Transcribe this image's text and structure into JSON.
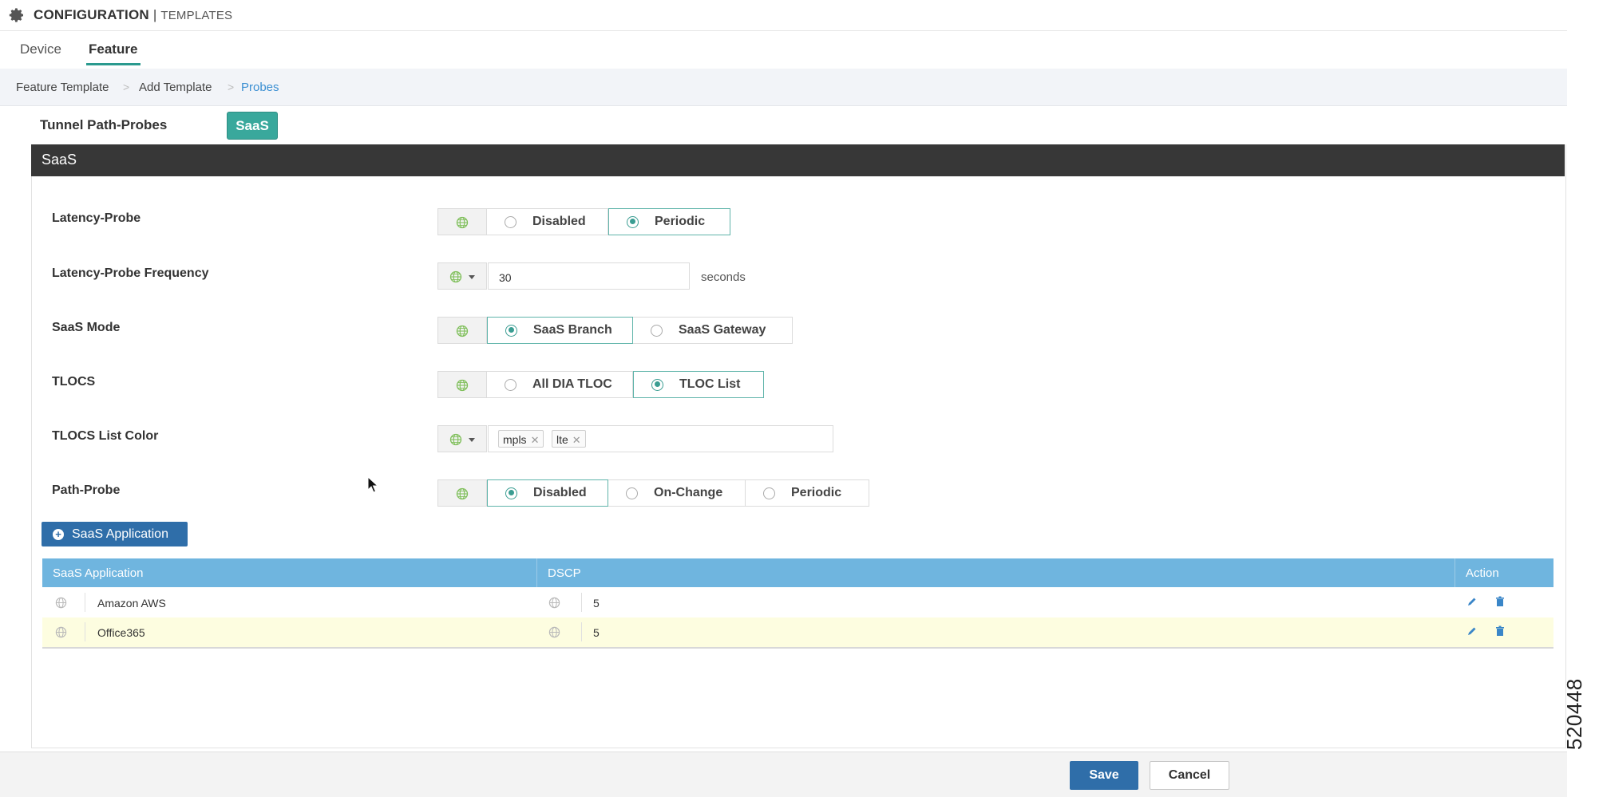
{
  "header": {
    "title": "CONFIGURATION",
    "separator": " | ",
    "subtitle": "TEMPLATES"
  },
  "tabs": [
    {
      "label": "Device"
    },
    {
      "label": "Feature",
      "active": true
    }
  ],
  "breadcrumb": {
    "items": [
      "Feature Template",
      "Add Template",
      "Probes"
    ],
    "separator": ">"
  },
  "probes": {
    "label": "Tunnel Path-Probes",
    "chip": "SaaS"
  },
  "panel": {
    "title": "SaaS"
  },
  "fields": {
    "latency_probe": {
      "label": "Latency-Probe",
      "options": [
        "Disabled",
        "Periodic"
      ],
      "selected": "Periodic"
    },
    "latency_freq": {
      "label": "Latency-Probe Frequency",
      "value": "30",
      "unit": "seconds"
    },
    "saas_mode": {
      "label": "SaaS Mode",
      "options": [
        "SaaS Branch",
        "SaaS Gateway"
      ],
      "selected": "SaaS Branch"
    },
    "tlocs": {
      "label": "TLOCS",
      "options": [
        "All DIA TLOC",
        "TLOC List"
      ],
      "selected": "TLOC List"
    },
    "tlocs_color": {
      "label": "TLOCS List Color",
      "tags": [
        "mpls",
        "lte"
      ],
      "remove_glyph": "✕"
    },
    "path_probe": {
      "label": "Path-Probe",
      "options": [
        "Disabled",
        "On-Change",
        "Periodic"
      ],
      "selected": "Disabled"
    }
  },
  "add_button": {
    "label": "SaaS Application",
    "glyph": "+"
  },
  "table": {
    "columns": [
      "SaaS Application",
      "DSCP",
      "Action"
    ],
    "rows": [
      {
        "app": "Amazon AWS",
        "dscp": "5"
      },
      {
        "app": "Office365",
        "dscp": "5"
      }
    ]
  },
  "footer": {
    "save": "Save",
    "cancel": "Cancel"
  },
  "figure_id": "520448",
  "colors": {
    "accent": "#39a89c",
    "primary": "#2f6ea9",
    "table_header": "#6fb5df",
    "panel_header": "#373737",
    "row_highlight": "#fdfde0"
  }
}
